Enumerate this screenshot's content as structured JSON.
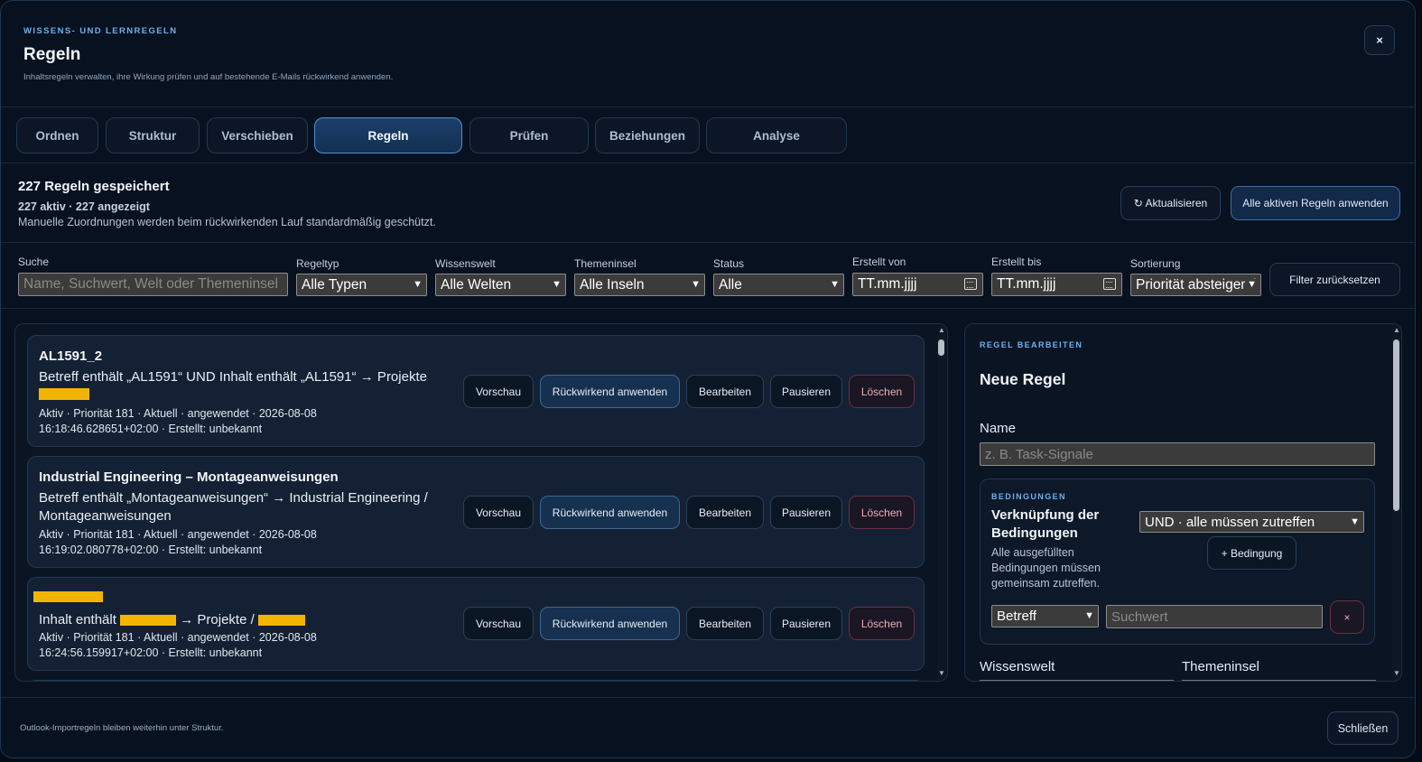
{
  "header": {
    "eyebrow": "WISSENS- UND LERNREGELN",
    "title": "Regeln",
    "subtitle": "Inhaltsregeln verwalten, ihre Wirkung prüfen und auf bestehende E-Mails rückwirkend anwenden.",
    "close_label": "×"
  },
  "tabs": [
    {
      "label": "Ordnen",
      "active": false
    },
    {
      "label": "Struktur",
      "active": false
    },
    {
      "label": "Verschieben",
      "active": false
    },
    {
      "label": "Regeln",
      "active": true
    },
    {
      "label": "Prüfen",
      "active": false
    },
    {
      "label": "Beziehungen",
      "active": false
    },
    {
      "label": "Analyse",
      "active": false
    }
  ],
  "summary": {
    "title": "227 Regeln gespeichert",
    "counts": "227 aktiv · 227 angezeigt",
    "note": "Manuelle Zuordnungen werden beim rückwirkenden Lauf standardmäßig geschützt.",
    "refresh_label": "↻ Aktualisieren",
    "apply_all_label": "Alle aktiven Regeln anwenden"
  },
  "filters": {
    "search": {
      "label": "Suche",
      "placeholder": "Name, Suchwert, Welt oder Themeninsel"
    },
    "type": {
      "label": "Regeltyp",
      "value": "Alle Typen"
    },
    "world": {
      "label": "Wissenswelt",
      "value": "Alle Welten"
    },
    "island": {
      "label": "Themeninsel",
      "value": "Alle Inseln"
    },
    "status": {
      "label": "Status",
      "value": "Alle"
    },
    "from": {
      "label": "Erstellt von",
      "value": "TT.mm.jjjj"
    },
    "to": {
      "label": "Erstellt bis",
      "value": "TT.mm.jjjj"
    },
    "sort": {
      "label": "Sortierung",
      "value": "Priorität absteigend"
    },
    "reset_label": "Filter zurücksetzen"
  },
  "rules": [
    {
      "title": "AL1591_2",
      "desc": "Betreff enthält „AL1591“ UND Inhalt enthält „AL1591“ → Projekte",
      "meta": "Aktiv · Priorität 181 · Aktuell · angewendet · 2026-08-08 16:18:46.628651+02:00 · Erstellt: unbekannt"
    },
    {
      "title": "Industrial Engineering – Montageanweisungen",
      "desc": "Betreff enthält „Montageanweisungen“ → Industrial Engineering / Montageanweisungen",
      "meta": "Aktiv · Priorität 181 · Aktuell · angewendet · 2026-08-08 16:19:02.080778+02:00 · Erstellt: unbekannt"
    },
    {
      "title": "",
      "desc_prefix": "Inhalt enthält",
      "desc_mid": "→ Projekte /",
      "meta": "Aktiv · Priorität 181 · Aktuell · angewendet · 2026-08-08 16:24:56.159917+02:00 · Erstellt: unbekannt"
    }
  ],
  "rule_actions": {
    "preview": "Vorschau",
    "retro": "Rückwirkend anwenden",
    "edit": "Bearbeiten",
    "pause": "Pausieren",
    "delete": "Löschen"
  },
  "editor": {
    "eyebrow": "REGEL BEARBEITEN",
    "title": "Neue Regel",
    "name_label": "Name",
    "name_placeholder": "z. B. Task-Signale",
    "conditions": {
      "eyebrow": "BEDINGUNGEN",
      "heading": "Verknüpfung der Bedingungen",
      "hint": "Alle ausgefüllten Bedingungen müssen gemeinsam zutreffen.",
      "join_value": "UND · alle müssen zutreffen",
      "add_label": "+ Bedingung",
      "field_value": "Betreff",
      "value_placeholder": "Suchwert",
      "remove_label": "×"
    },
    "world_label": "Wissenswelt",
    "island_label": "Themeninsel"
  },
  "footer": {
    "note": "Outlook-Importregeln bleiben weiterhin unter Struktur.",
    "close_label": "Schließen"
  }
}
